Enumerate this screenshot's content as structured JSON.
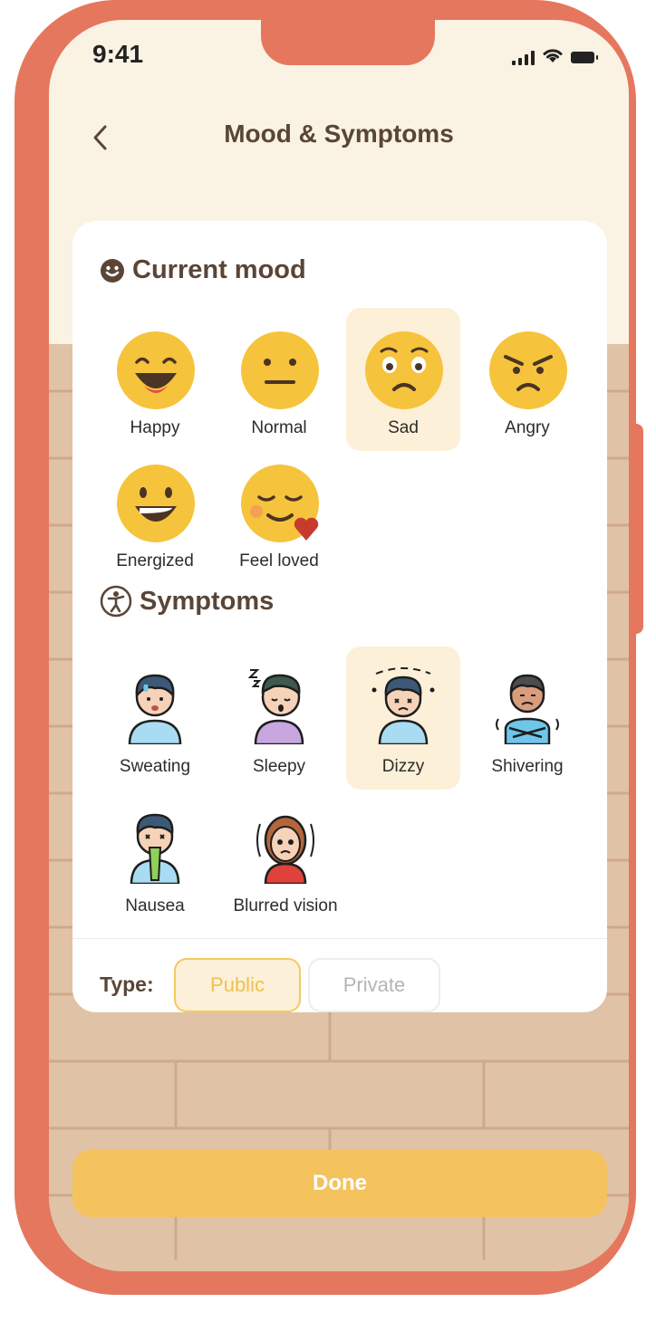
{
  "status": {
    "time": "9:41"
  },
  "header": {
    "title": "Mood & Symptoms"
  },
  "mood": {
    "title": "Current mood",
    "items": [
      {
        "label": "Happy",
        "icon": "happy-face-icon",
        "selected": false
      },
      {
        "label": "Normal",
        "icon": "neutral-face-icon",
        "selected": false
      },
      {
        "label": "Sad",
        "icon": "sad-face-icon",
        "selected": true
      },
      {
        "label": "Angry",
        "icon": "angry-face-icon",
        "selected": false
      },
      {
        "label": "Energized",
        "icon": "grinning-face-icon",
        "selected": false
      },
      {
        "label": "Feel loved",
        "icon": "loved-face-icon",
        "selected": false
      }
    ]
  },
  "symptoms": {
    "title": "Symptoms",
    "items": [
      {
        "label": "Sweating",
        "icon": "sweating-person-icon",
        "selected": false
      },
      {
        "label": "Sleepy",
        "icon": "sleepy-person-icon",
        "selected": false
      },
      {
        "label": "Dizzy",
        "icon": "dizzy-person-icon",
        "selected": true
      },
      {
        "label": "Shivering",
        "icon": "shivering-person-icon",
        "selected": false
      },
      {
        "label": "Nausea",
        "icon": "nausea-person-icon",
        "selected": false
      },
      {
        "label": "Blurred vision",
        "icon": "blurred-vision-person-icon",
        "selected": false
      }
    ]
  },
  "type": {
    "label": "Type:",
    "options": [
      "Public",
      "Private"
    ],
    "selected": "Public"
  },
  "done_label": "Done",
  "colors": {
    "accent": "#f4c35d",
    "frame": "#e5775f",
    "selected_bg": "#fdf0d8",
    "title": "#5a4536"
  }
}
